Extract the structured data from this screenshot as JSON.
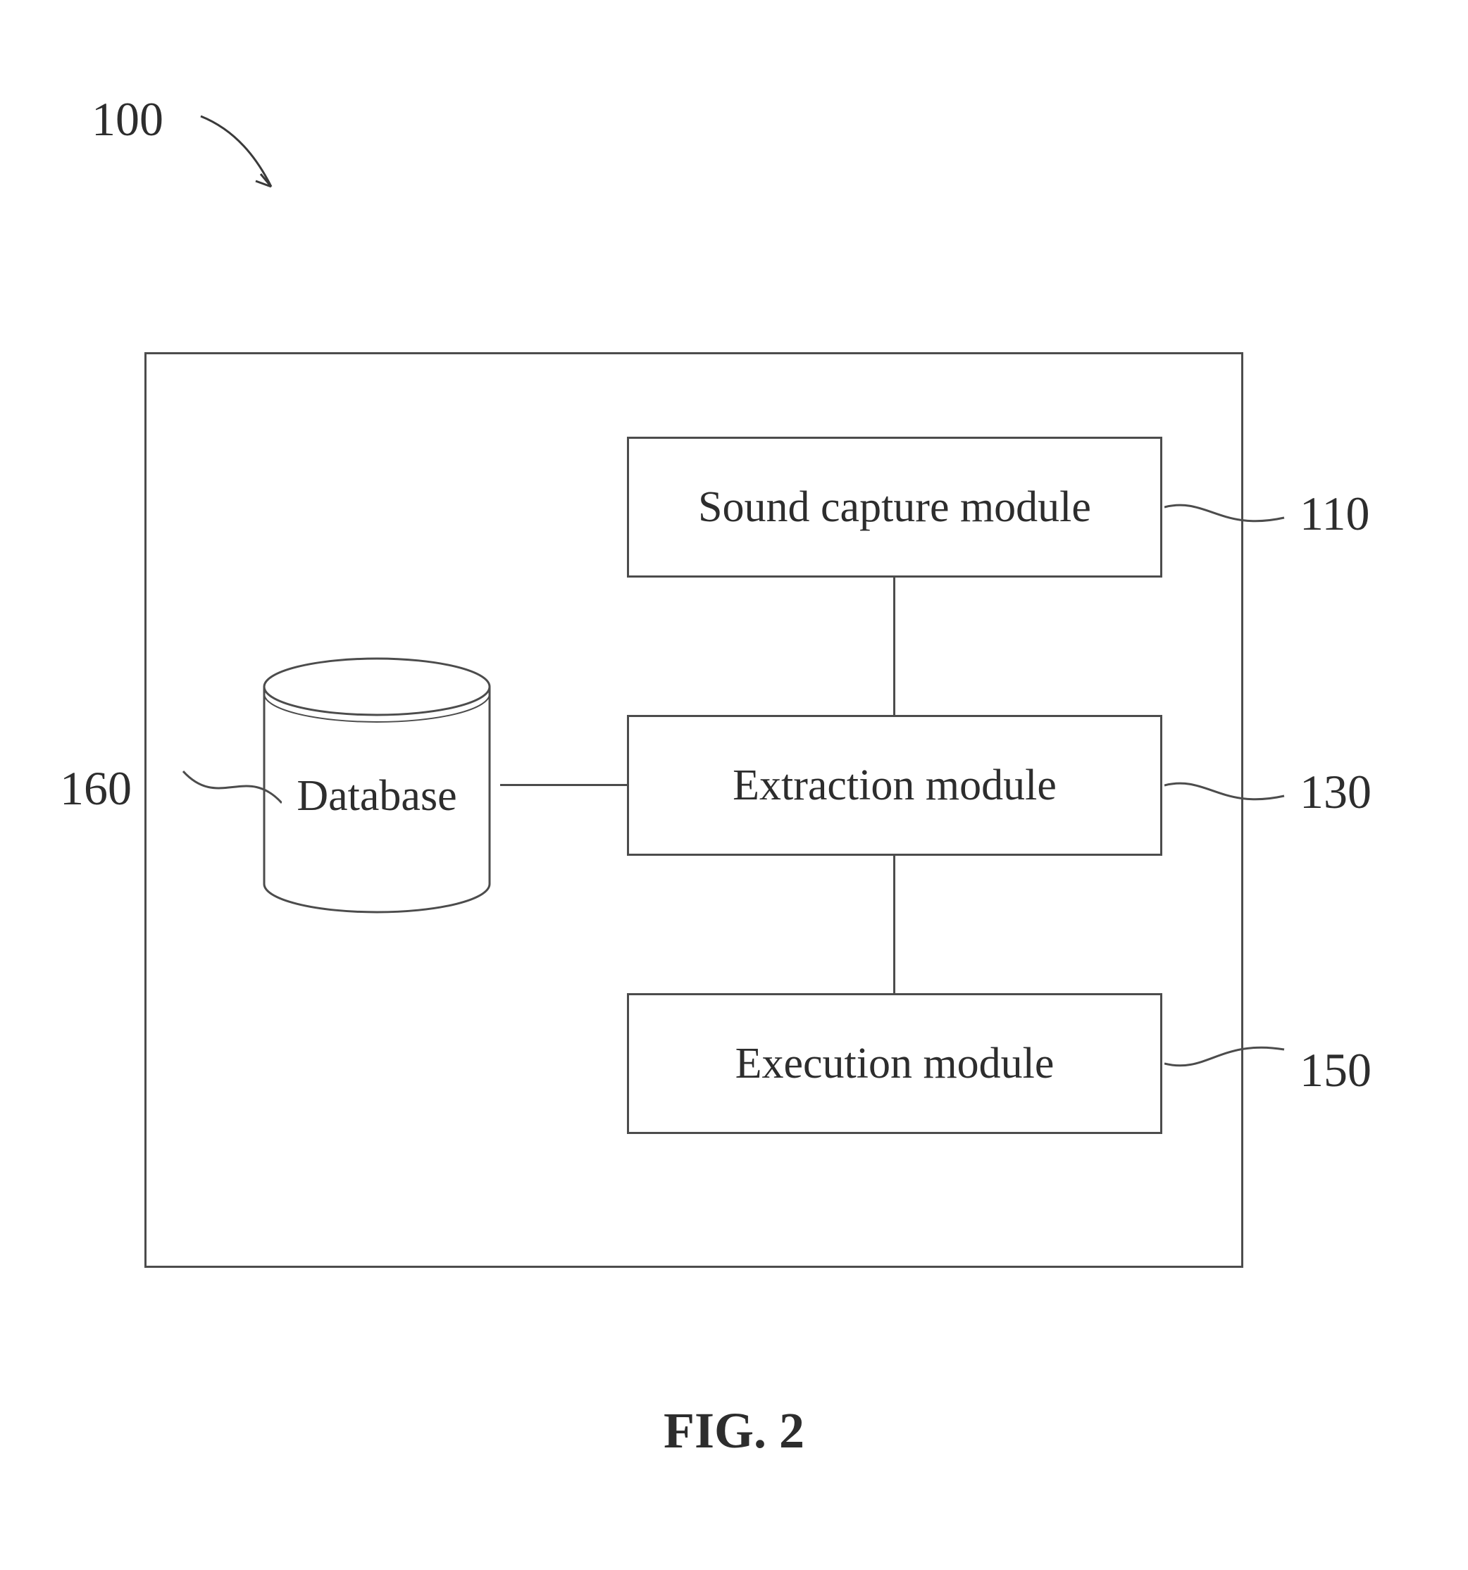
{
  "system_ref": "100",
  "database": {
    "label": "Database",
    "ref": "160"
  },
  "modules": {
    "sound_capture": {
      "label": "Sound capture module",
      "ref": "110"
    },
    "extraction": {
      "label": "Extraction module",
      "ref": "130"
    },
    "execution": {
      "label": "Execution module",
      "ref": "150"
    }
  },
  "figure_caption": "FIG. 2"
}
